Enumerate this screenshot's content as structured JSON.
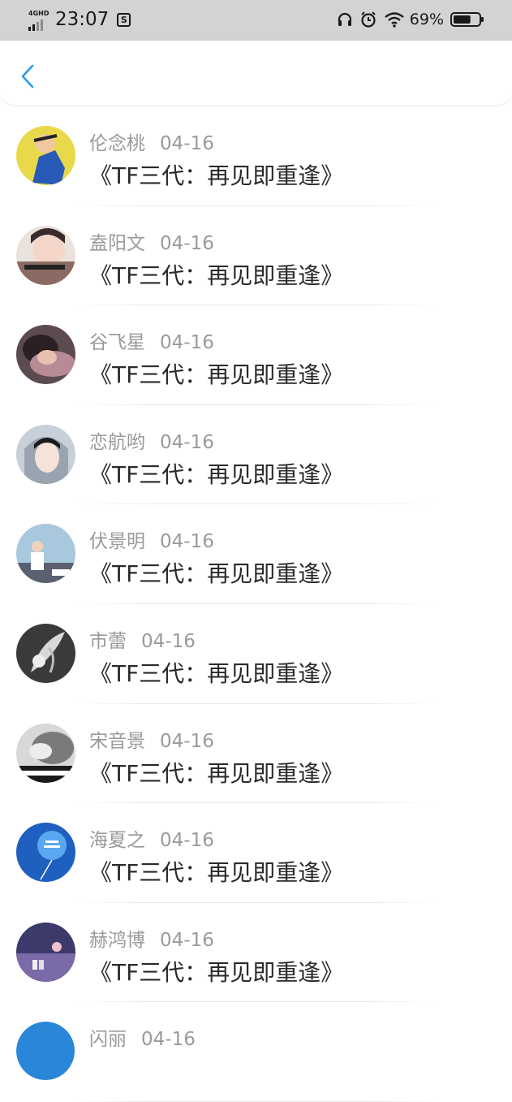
{
  "status_bar": {
    "network": "4GHD",
    "time": "23:07",
    "extra_icon": "S",
    "battery_percent": "69%",
    "battery_level": 0.69,
    "icons": [
      "headphones-icon",
      "alarm-icon",
      "wifi-icon",
      "battery-icon"
    ]
  },
  "header": {
    "back_icon": "chevron-left-icon",
    "accent_color": "#2b9be8"
  },
  "list": [
    {
      "name": "伦念桃",
      "date": "04-16",
      "title": "《TF三代：再见即重逢》",
      "avatar_color": "#e8d94a"
    },
    {
      "name": "盍阳文",
      "date": "04-16",
      "title": "《TF三代：再见即重逢》",
      "avatar_color": "#8a6a62"
    },
    {
      "name": "谷飞星",
      "date": "04-16",
      "title": "《TF三代：再见即重逢》",
      "avatar_color": "#5b4a4e"
    },
    {
      "name": "恋航哟",
      "date": "04-16",
      "title": "《TF三代：再见即重逢》",
      "avatar_color": "#c7cfd8"
    },
    {
      "name": "伏景明",
      "date": "04-16",
      "title": "《TF三代：再见即重逢》",
      "avatar_color": "#a8c8de"
    },
    {
      "name": "市蕾",
      "date": "04-16",
      "title": "《TF三代：再见即重逢》",
      "avatar_color": "#3a3a3a"
    },
    {
      "name": "宋音景",
      "date": "04-16",
      "title": "《TF三代：再见即重逢》",
      "avatar_color": "#7a7a7a"
    },
    {
      "name": "海夏之",
      "date": "04-16",
      "title": "《TF三代：再见即重逢》",
      "avatar_color": "#1f5fc0"
    },
    {
      "name": "赫鸿博",
      "date": "04-16",
      "title": "《TF三代：再见即重逢》",
      "avatar_color": "#3c3a6a"
    },
    {
      "name": "闪丽",
      "date": "04-16",
      "title": "",
      "avatar_color": "#2a86d8"
    }
  ]
}
